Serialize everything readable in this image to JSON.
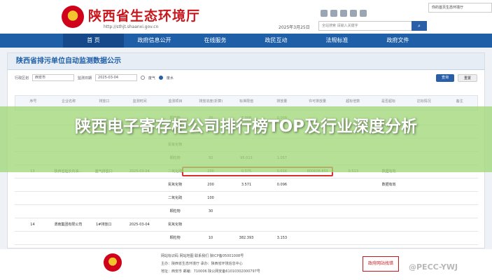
{
  "header": {
    "site_title": "陕西省生态环境厅",
    "site_url": "http://sthjt.shaanxi.gov.cn",
    "date": "2025年3月25日",
    "search_placeholder": "全站搜索 请输入关键字",
    "top_right_text": "你的首页生态环境厅"
  },
  "nav": [
    "首 页",
    "政府信息公开",
    "在线服务",
    "政民互动",
    "法规标准",
    "政府文件"
  ],
  "panel": {
    "title": "陕西省排污单位自动监测数据公示",
    "filters": {
      "region_label": "行政区划",
      "region_value": "西安市",
      "date_label": "监测日期",
      "date_value": "2025-03-04",
      "radio_gas": "废气",
      "radio_water": "废水",
      "query": "查询",
      "reset": "重置"
    },
    "columns": [
      "序号",
      "企业名称",
      "排放口",
      "监测时间",
      "监测项目",
      "排放浓度(折算)",
      "标准限值",
      "排放量",
      "许可排放量",
      "超标倍数",
      "是否超标",
      "达标情况",
      "备注"
    ]
  },
  "rows": [
    {
      "no": "",
      "company": "",
      "outlet": "",
      "time": "",
      "item": "颗粒物",
      "conc": "20",
      "limit": "7.008",
      "amount": "0.009"
    },
    {
      "no": "",
      "company": "",
      "outlet": "",
      "time": "",
      "item": "二氧化硫",
      "conc": "",
      "limit": "",
      "amount": ""
    },
    {
      "no": "",
      "company": "",
      "outlet": "",
      "time": "",
      "item": "氮氧化物",
      "conc": "",
      "limit": "",
      "amount": ""
    },
    {
      "no": "",
      "company": "",
      "outlet": "",
      "time": "",
      "item": "颗粒物",
      "conc": "50",
      "limit": "95.013",
      "amount": "1.057"
    },
    {
      "no": "13",
      "company": "陕西省延长石油...",
      "outlet": "废气排放口",
      "time": "2025-03-04",
      "item": "二氧化硫",
      "conc": "200",
      "limit": "0.575",
      "amount": "0.016",
      "permit": "800608.855",
      "ratio": "0.513",
      "status": "数据有效"
    },
    {
      "no": "",
      "company": "",
      "outlet": "",
      "time": "",
      "item": "氮氧化物",
      "conc": "200",
      "limit": "3.571",
      "amount": "0.096",
      "status": "数据有效"
    },
    {
      "no": "",
      "company": "",
      "outlet": "",
      "time": "",
      "item": "二氧化硫",
      "conc": "100",
      "limit": "",
      "amount": ""
    },
    {
      "no": "",
      "company": "",
      "outlet": "",
      "time": "",
      "item": "颗粒物",
      "conc": "30",
      "limit": "",
      "amount": ""
    },
    {
      "no": "14",
      "company": "渭南集团有限公司",
      "outlet": "1#排放口",
      "time": "2025-03-04",
      "item": "氮氧化物",
      "conc": "",
      "limit": "",
      "amount": ""
    },
    {
      "no": "",
      "company": "",
      "outlet": "",
      "time": "",
      "item": "颗粒物",
      "conc": "10",
      "limit": "382.393",
      "amount": "3.153"
    }
  ],
  "banner": {
    "title": "陕西电子寄存柜公司排行榜TOP及行业深度分析"
  },
  "footer": {
    "line1": "网站标识码  网站地图  联系我们  陕ICP备05001008号",
    "line2": "主办：陕西省生态环境厅  承办：陕西省环境信息中心",
    "line3": "地址：西安市  邮编：710006  陕公网安备61010302000797号",
    "badge": "政府网站找错",
    "watermark": "@PECC-YWJ"
  },
  "colors": {
    "primary": "#1f5fa8",
    "title_red": "#c8161d",
    "banner": "#a0d778",
    "highlight": "#d9302c"
  }
}
